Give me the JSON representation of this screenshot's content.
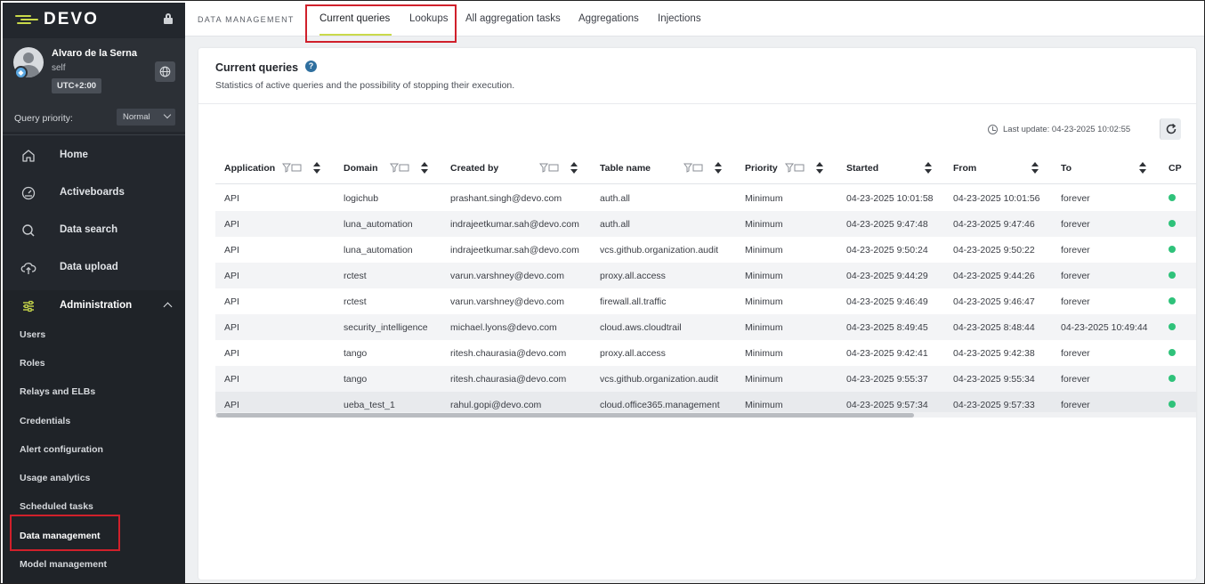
{
  "brand": {
    "name": "DEVO"
  },
  "user": {
    "name": "Alvaro de la Serna",
    "role": "self",
    "timezone": "UTC+2:00"
  },
  "priority": {
    "label": "Query priority:",
    "value": "Normal"
  },
  "nav": {
    "home": "Home",
    "activeboards": "Activeboards",
    "data_search": "Data search",
    "data_upload": "Data upload",
    "administration": "Administration"
  },
  "admin_items": [
    "Users",
    "Roles",
    "Relays and ELBs",
    "Credentials",
    "Alert configuration",
    "Usage analytics",
    "Scheduled tasks",
    "Data management",
    "Model management"
  ],
  "topbar": {
    "section": "DATA MANAGEMENT",
    "tabs": [
      "Current queries",
      "Lookups",
      "All aggregation tasks",
      "Aggregations",
      "Injections"
    ]
  },
  "card": {
    "title": "Current queries",
    "help": "?",
    "subtitle": "Statistics of active queries and the possibility of stopping their execution.",
    "last_update": "Last update: 04-23-2025 10:02:55"
  },
  "table": {
    "columns": [
      "Application",
      "Domain",
      "Created by",
      "Table name",
      "Priority",
      "Started",
      "From",
      "To",
      "CP"
    ],
    "rows": [
      [
        "API",
        "logichub",
        "prashant.singh@devo.com",
        "auth.all",
        "Minimum",
        "04-23-2025 10:01:58",
        "04-23-2025 10:01:56",
        "forever"
      ],
      [
        "API",
        "luna_automation",
        "indrajeetkumar.sah@devo.com",
        "auth.all",
        "Minimum",
        "04-23-2025 9:47:48",
        "04-23-2025 9:47:46",
        "forever"
      ],
      [
        "API",
        "luna_automation",
        "indrajeetkumar.sah@devo.com",
        "vcs.github.organization.audit",
        "Minimum",
        "04-23-2025 9:50:24",
        "04-23-2025 9:50:22",
        "forever"
      ],
      [
        "API",
        "rctest",
        "varun.varshney@devo.com",
        "proxy.all.access",
        "Minimum",
        "04-23-2025 9:44:29",
        "04-23-2025 9:44:26",
        "forever"
      ],
      [
        "API",
        "rctest",
        "varun.varshney@devo.com",
        "firewall.all.traffic",
        "Minimum",
        "04-23-2025 9:46:49",
        "04-23-2025 9:46:47",
        "forever"
      ],
      [
        "API",
        "security_intelligence",
        "michael.lyons@devo.com",
        "cloud.aws.cloudtrail",
        "Minimum",
        "04-23-2025 8:49:45",
        "04-23-2025 8:48:44",
        "04-23-2025 10:49:44"
      ],
      [
        "API",
        "tango",
        "ritesh.chaurasia@devo.com",
        "proxy.all.access",
        "Minimum",
        "04-23-2025 9:42:41",
        "04-23-2025 9:42:38",
        "forever"
      ],
      [
        "API",
        "tango",
        "ritesh.chaurasia@devo.com",
        "vcs.github.organization.audit",
        "Minimum",
        "04-23-2025 9:55:37",
        "04-23-2025 9:55:34",
        "forever"
      ],
      [
        "API",
        "ueba_test_1",
        "rahul.gopi@devo.com",
        "cloud.office365.management",
        "Minimum",
        "04-23-2025 9:57:34",
        "04-23-2025 9:57:33",
        "forever"
      ]
    ]
  },
  "colors": {
    "accent": "#c9d94a",
    "sidebar": "#23272d",
    "status_dot": "#2fc27a",
    "highlight_box": "#d0202b"
  }
}
